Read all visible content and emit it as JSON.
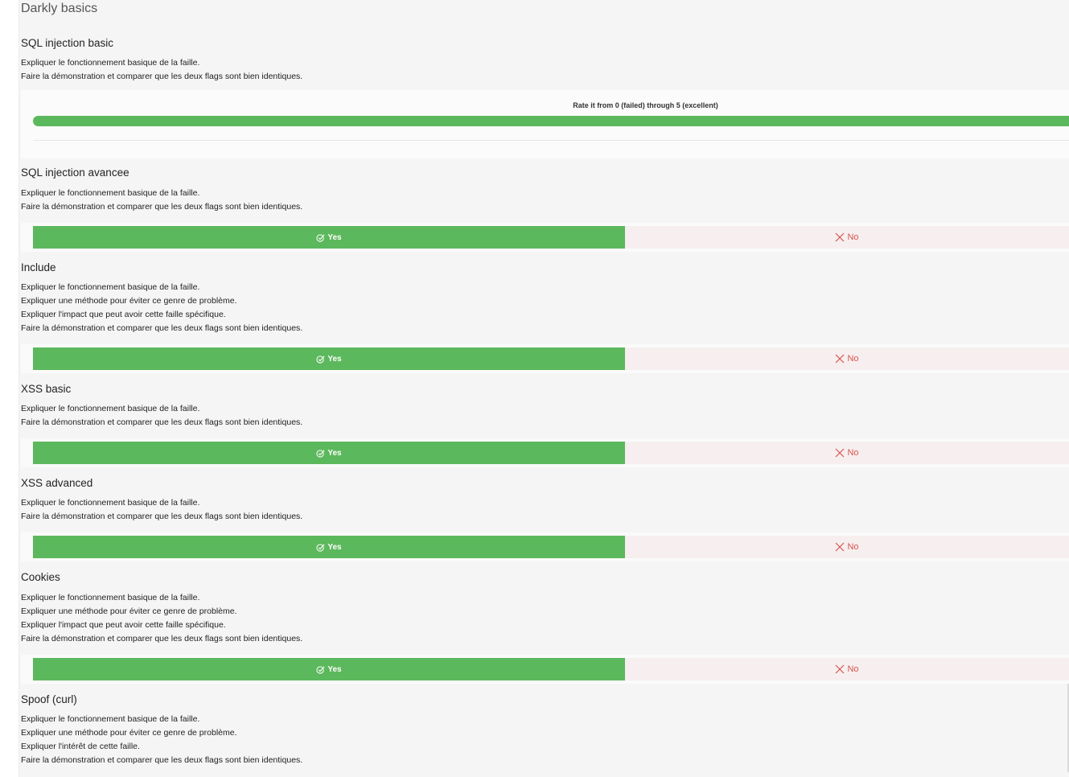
{
  "section": {
    "title": "Darkly basics"
  },
  "rating": {
    "label": "Rate it from 0 (failed) through 5 (excellent)"
  },
  "buttons": {
    "yes_label": "Yes",
    "no_label": "No"
  },
  "items": [
    {
      "title": "SQL injection basic",
      "lines": [
        "Expliquer le fonctionnement basique de la faille.",
        "Faire la démonstration et comparer que les deux flags sont bien identiques."
      ]
    },
    {
      "title": "SQL injection avancee",
      "lines": [
        "Expliquer le fonctionnement basique de la faille.",
        "Faire la démonstration et comparer que les deux flags sont bien identiques."
      ]
    },
    {
      "title": "Include",
      "lines": [
        "Expliquer le fonctionnement basique de la faille.",
        "Expliquer une méthode pour éviter ce genre de problème.",
        "Expliquer l'impact que peut avoir cette faille spécifique.",
        "Faire la démonstration et comparer que les deux flags sont bien identiques."
      ]
    },
    {
      "title": "XSS basic",
      "lines": [
        "Expliquer le fonctionnement basique de la faille.",
        "Faire la démonstration et comparer que les deux flags sont bien identiques."
      ]
    },
    {
      "title": "XSS advanced",
      "lines": [
        "Expliquer le fonctionnement basique de la faille.",
        "Faire la démonstration et comparer que les deux flags sont bien identiques."
      ]
    },
    {
      "title": "Cookies",
      "lines": [
        "Expliquer le fonctionnement basique de la faille.",
        "Expliquer une méthode pour éviter ce genre de problème.",
        "Expliquer l'impact que peut avoir cette faille spécifique.",
        "Faire la démonstration et comparer que les deux flags sont bien identiques."
      ]
    },
    {
      "title": "Spoof (curl)",
      "lines": [
        "Expliquer le fonctionnement basique de la faille.",
        "Expliquer une méthode pour éviter ce genre de problème.",
        "Expliquer l'intérêt de cette faille.",
        "Faire la démonstration et comparer que les deux flags sont bien identiques."
      ]
    }
  ],
  "colors": {
    "yes": "#5cb85c",
    "no_text": "#d9534f",
    "no_bg": "#f7efef"
  },
  "icons": {
    "yes": "check-circle-icon",
    "no": "x-icon"
  }
}
